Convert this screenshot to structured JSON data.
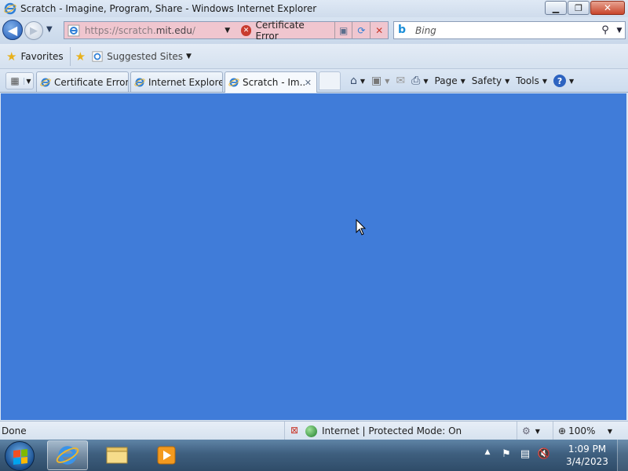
{
  "window": {
    "title": "Scratch - Imagine, Program, Share - Windows Internet Explorer",
    "minimize_label": "▁",
    "maximize_label": "❐",
    "close_label": "✕"
  },
  "navigation": {
    "url_prefix": "https://scratch.",
    "url_domain": "mit.edu",
    "url_suffix": "/",
    "certificate_error": "Certificate Error",
    "search_placeholder": "Bing"
  },
  "favorites_bar": {
    "favorites_label": "Favorites",
    "suggested_sites_label": "Suggested Sites"
  },
  "tabs": [
    {
      "label": "Certificate Error...",
      "active": false
    },
    {
      "label": "Internet Explore...",
      "active": false
    },
    {
      "label": "Scratch - Im...",
      "active": true
    }
  ],
  "command_bar": {
    "page_label": "Page",
    "safety_label": "Safety",
    "tools_label": "Tools"
  },
  "content": {
    "background_color": "#407cd9"
  },
  "status_bar": {
    "status_text": "Done",
    "zone_text": "Internet | Protected Mode: On",
    "zoom_text": "100%"
  },
  "taskbar": {
    "time": "1:09 PM",
    "date": "3/4/2023"
  },
  "icons": [
    "ie-icon",
    "back-arrow-icon",
    "forward-arrow-icon",
    "certificate-error-icon",
    "compatibility-view-icon",
    "refresh-icon",
    "stop-icon",
    "bing-icon",
    "search-icon",
    "favorites-star-icon",
    "add-favorites-icon",
    "quick-tabs-icon",
    "home-icon",
    "feeds-icon",
    "read-mail-icon",
    "print-icon",
    "help-icon",
    "globe-icon",
    "zoom-icon",
    "start-orb-icon",
    "explorer-folder-icon",
    "media-player-icon",
    "flag-icon",
    "network-icon",
    "volume-muted-icon"
  ]
}
